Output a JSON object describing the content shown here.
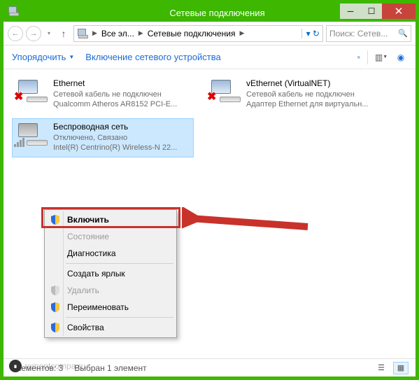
{
  "window": {
    "title": "Сетевые подключения"
  },
  "nav": {
    "crumb1": "Все эл...",
    "crumb2": "Сетевые подключения",
    "search_placeholder": "Поиск: Сетев..."
  },
  "cmdbar": {
    "organize": "Упорядочить",
    "enable_device": "Включение сетевого устройства"
  },
  "items": {
    "ethernet": {
      "name": "Ethernet",
      "line2": "Сетевой кабель не подключен",
      "line3": "Qualcomm Atheros AR8152 PCI-E..."
    },
    "vethernet": {
      "name": "vEthernet (VirtualNET)",
      "line2": "Сетевой кабель не подключен",
      "line3": "Адаптер Ethernet для виртуальн..."
    },
    "wifi": {
      "name": "Беспроводная сеть",
      "line2": "Отключено, Связано",
      "line3": "Intel(R) Centrino(R) Wireless-N 22..."
    }
  },
  "context_menu": {
    "enable": "Включить",
    "status": "Состояние",
    "diagnose": "Диагностика",
    "create_shortcut": "Создать ярлык",
    "delete": "Удалить",
    "rename": "Переименовать",
    "properties": "Свойства"
  },
  "statusbar": {
    "count": "Элементов: 3",
    "selected": "Выбран 1 элемент"
  },
  "watermark": "remontcompa.ru"
}
